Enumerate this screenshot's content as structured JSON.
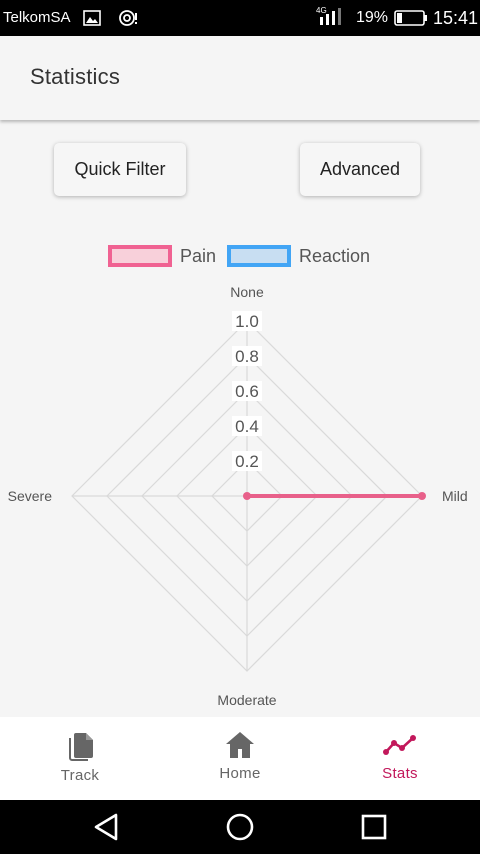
{
  "status_bar": {
    "carrier": "TelkomSA",
    "network": "4G",
    "battery_percent": "19%",
    "time": "15:41"
  },
  "app_bar": {
    "title": "Statistics"
  },
  "filters": {
    "quick_filter_label": "Quick Filter",
    "advanced_label": "Advanced"
  },
  "legend": {
    "pain": {
      "label": "Pain",
      "border": "#f06292",
      "fill": "#f8d0da"
    },
    "reaction": {
      "label": "Reaction",
      "border": "#42a5f5",
      "fill": "#c8def2"
    }
  },
  "chart_data": {
    "type": "radar",
    "axes": [
      "None",
      "Mild",
      "Moderate",
      "Severe"
    ],
    "ticks": [
      "1.0",
      "0.8",
      "0.6",
      "0.4",
      "0.2"
    ],
    "range": [
      0,
      1
    ],
    "series": [
      {
        "name": "Pain",
        "values": [
          0,
          1,
          0,
          0
        ],
        "color": "#e8608a"
      },
      {
        "name": "Reaction",
        "values": [
          0,
          0,
          0,
          0
        ],
        "color": "#42a5f5"
      }
    ]
  },
  "bottom_nav": {
    "items": [
      {
        "label": "Track",
        "icon": "file-copy-icon"
      },
      {
        "label": "Home",
        "icon": "home-icon"
      },
      {
        "label": "Stats",
        "icon": "line-chart-icon",
        "active": true
      }
    ],
    "active_color": "#c2185b"
  }
}
